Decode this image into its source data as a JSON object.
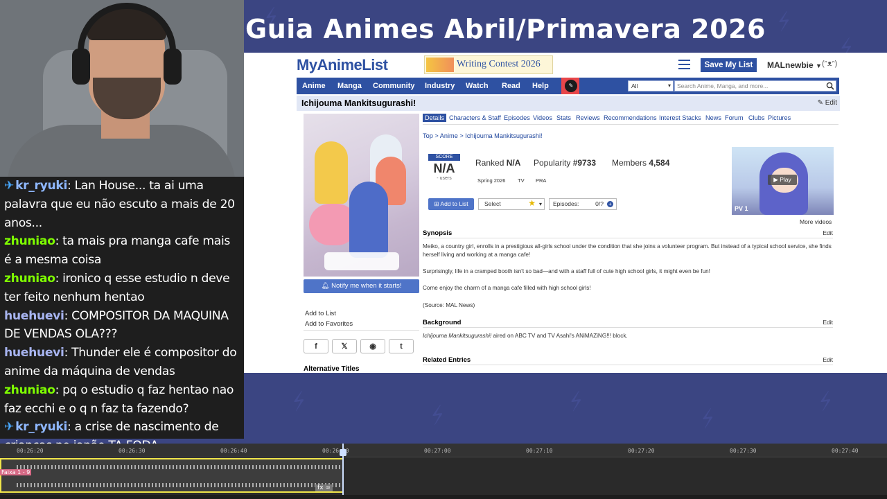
{
  "stream": {
    "title": "Guia Animes Abril/Primavera 2026"
  },
  "chat": {
    "messages": [
      {
        "badge": "✈",
        "user": "kr_ryuki",
        "color": "#8fb8ff",
        "text": ": Lan House... ta ai uma palavra que eu não escuto a mais de 20 anos..."
      },
      {
        "badge": "",
        "user": "zhuniao",
        "color": "#7fff00",
        "text": ": ta mais pra manga cafe mais é a mesma coisa"
      },
      {
        "badge": "",
        "user": "zhuniao",
        "color": "#7fff00",
        "text": ": ironico q esse estudio n deve ter feito nenhum hentao"
      },
      {
        "badge": "",
        "user": "huehuevi",
        "color": "#a7b4f0",
        "text": ": COMPOSITOR DA MAQUINA DE VENDAS OLA???"
      },
      {
        "badge": "",
        "user": "huehuevi",
        "color": "#a7b4f0",
        "text": ": Thunder ele é compositor do anime da máquina de vendas"
      },
      {
        "badge": "",
        "user": "zhuniao",
        "color": "#7fff00",
        "text": ": pq o estudio q faz hentao nao faz ecchi e o q n faz ta fazendo?"
      },
      {
        "badge": "✈",
        "user": "kr_ryuki",
        "color": "#8fb8ff",
        "text": ": a crise de nascimento de crianças no japão TA FODA"
      }
    ]
  },
  "mal": {
    "logo": "MyAnimeList",
    "contest": "Writing Contest 2026",
    "save_list": "Save My List",
    "username": "MALnewbie",
    "user_extra": "(ᵔᴥᵔ)",
    "nav": [
      "Anime",
      "Manga",
      "Community",
      "Industry",
      "Watch",
      "Read",
      "Help"
    ],
    "search_category": "All",
    "search_placeholder": "Search Anime, Manga, and more...",
    "title": "Ichijouma Mankitsugurashi!",
    "edit": "Edit",
    "tabs": [
      "Details",
      "Characters & Staff",
      "Episodes",
      "Videos",
      "Stats",
      "Reviews",
      "Recommendations",
      "Interest Stacks",
      "News",
      "Forum",
      "Clubs",
      "Pictures"
    ],
    "breadcrumb": "Top  >  Anime  >  Ichijouma Mankitsugurashi!",
    "score": {
      "label": "SCORE",
      "value": "N/A",
      "users": "- users"
    },
    "ranked": {
      "label": "Ranked ",
      "value": "N/A"
    },
    "popularity": {
      "label": "Popularity ",
      "value": "#9733"
    },
    "members": {
      "label": "Members ",
      "value": "4,584"
    },
    "season": "Spring 2026",
    "type": "TV",
    "studio": "PRA",
    "add_to_list": "Add to List",
    "status_select": "Select",
    "episodes_label": "Episodes:",
    "episodes_count": "0/?",
    "video": {
      "play": "Play",
      "label": "PV 1"
    },
    "more_videos": "More videos",
    "notify": "Notify me when it starts!",
    "side_links": [
      "Add to List",
      "Add to Favorites"
    ],
    "share": [
      "f",
      "𝕏",
      "◉",
      "t"
    ],
    "alt_titles": "Alternative Titles",
    "synopsis_title": "Synopsis",
    "synopsis": [
      "Meiko, a country girl, enrolls in a prestigious all-girls school under the condition that she joins a volunteer program. But instead of a typical school service, she finds herself living and working at a manga cafe!",
      "Surprisingly, life in a cramped booth isn't so bad—and with a staff full of cute high school girls, it might even be fun!",
      "Come enjoy the charm of a manga cafe filled with high school girls!",
      "(Source: MAL News)"
    ],
    "background_title": "Background",
    "background_italic": "Ichijouma Mankitsugurashi!",
    "background_text": " aired on ABC TV and TV Asahi's ANiMAZiNG!!! block.",
    "related_title": "Related Entries"
  },
  "timeline": {
    "ticks": [
      "00:26:20",
      "00:26:30",
      "00:26:40",
      "00:26:50",
      "00:27:00",
      "00:27:10",
      "00:27:20",
      "00:27:30",
      "00:27:40"
    ],
    "clip_label": "Faixa 1 - 9",
    "fx": "fx ∞"
  }
}
